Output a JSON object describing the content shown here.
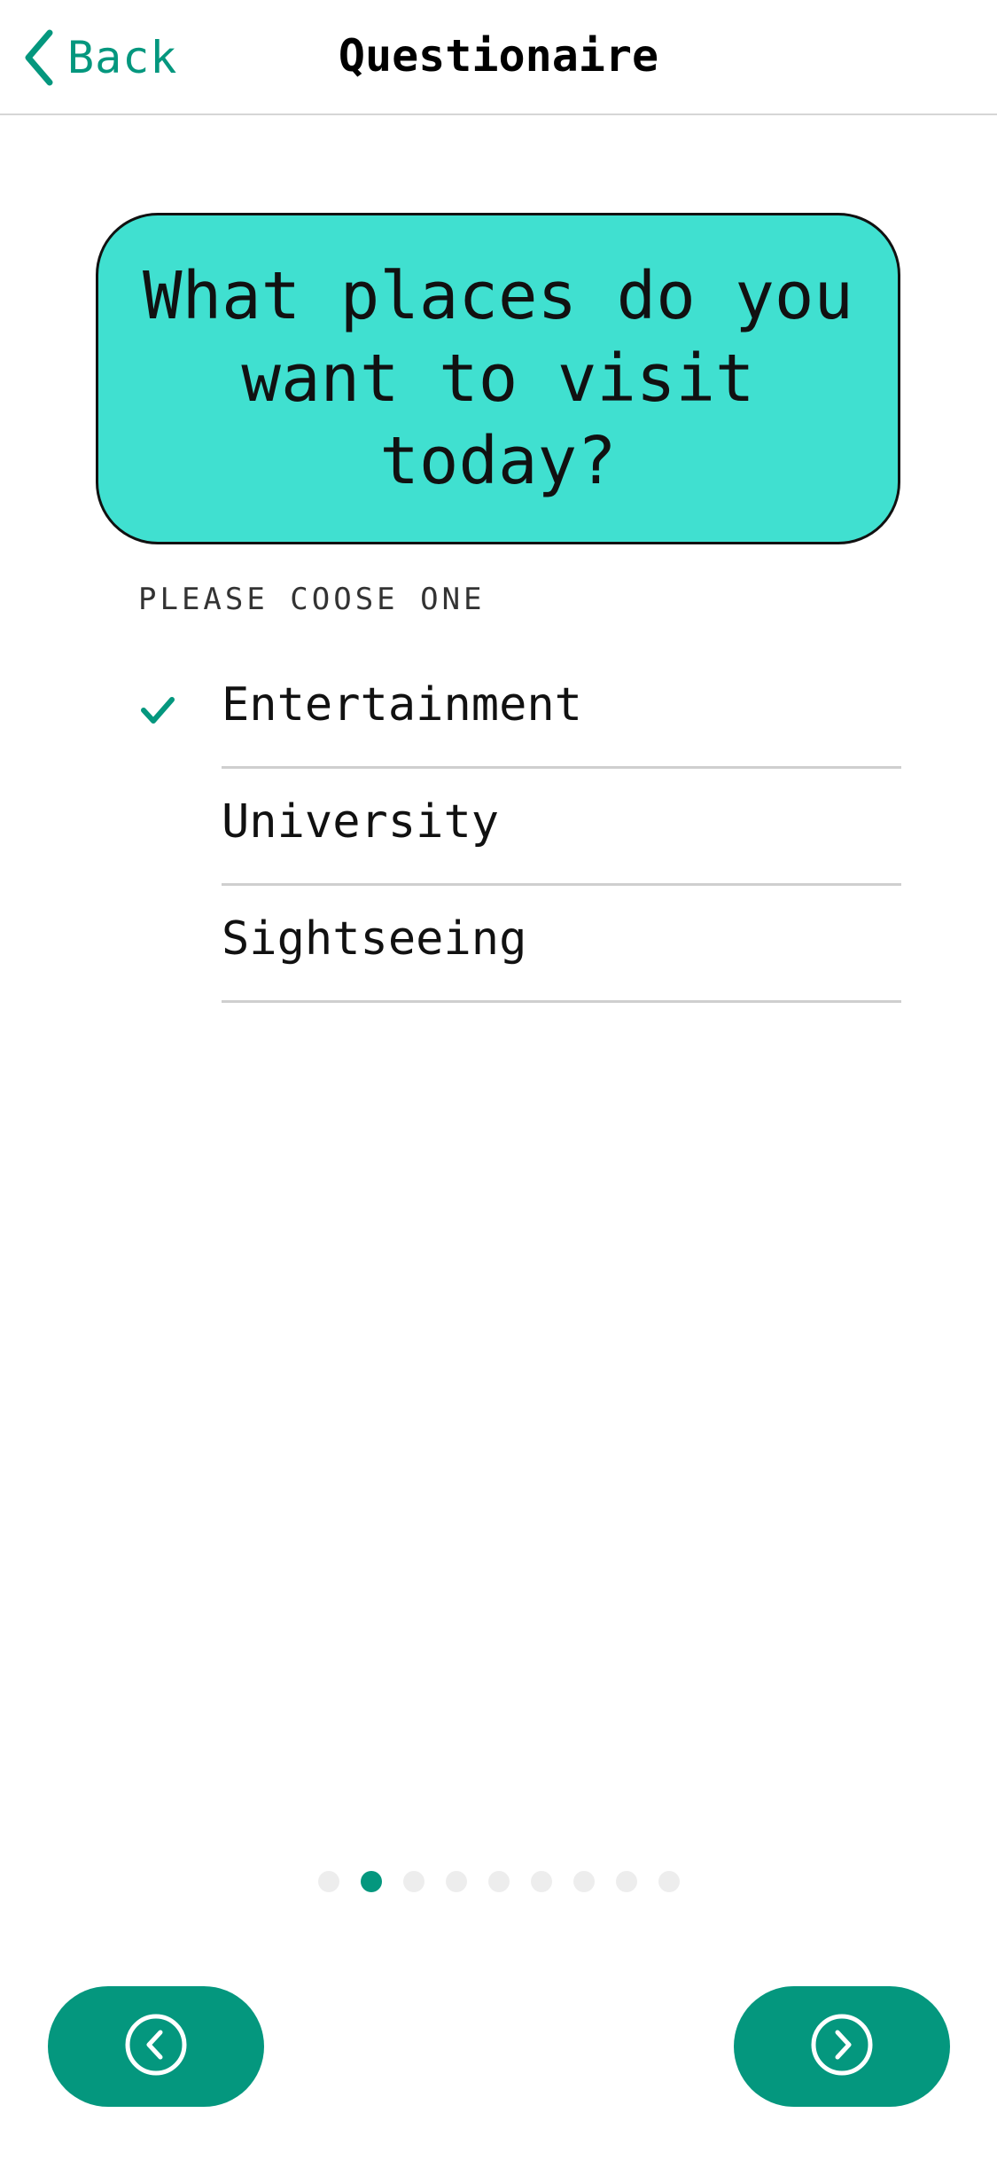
{
  "header": {
    "back_label": "Back",
    "title": "Questionaire"
  },
  "question": {
    "text": "What places do you want to visit today?",
    "hint": "PLEASE COOSE ONE"
  },
  "options": [
    {
      "label": "Entertainment",
      "selected": true
    },
    {
      "label": "University",
      "selected": false
    },
    {
      "label": "Sightseeing",
      "selected": false
    }
  ],
  "pager": {
    "total": 9,
    "current": 2
  },
  "nav": {
    "prev_icon": "chevron-left-circle-icon",
    "next_icon": "chevron-right-circle-icon"
  },
  "colors": {
    "accent": "#04977e",
    "card": "#40e0d0"
  }
}
